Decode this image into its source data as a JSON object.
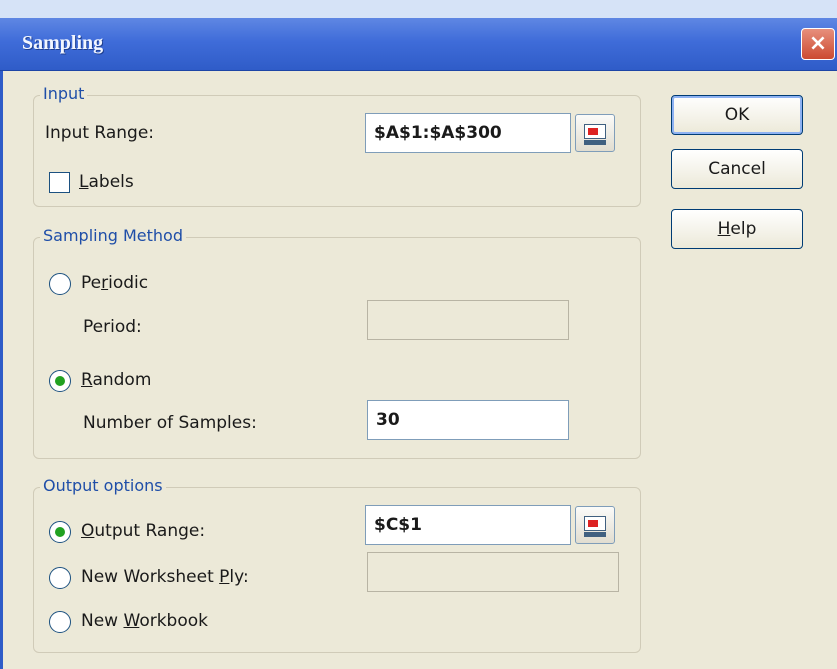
{
  "window": {
    "title": "Sampling",
    "close_glyph": "×"
  },
  "input": {
    "legend": "Input",
    "range_label": "Input Range:",
    "range_value": "$A$1:$A$300",
    "labels_checkbox": {
      "label_pre": "",
      "label_accel": "L",
      "label_post": "abels",
      "checked": false
    }
  },
  "method": {
    "legend": "Sampling Method",
    "periodic": {
      "pre": "Pe",
      "accel": "r",
      "post": "iodic",
      "selected": false
    },
    "period_label": "Period:",
    "period_value": "",
    "random": {
      "pre": "",
      "accel": "R",
      "post": "andom",
      "selected": true
    },
    "samples_label": "Number of Samples:",
    "samples_value": "30"
  },
  "output": {
    "legend": "Output options",
    "output_range": {
      "pre": "",
      "accel": "O",
      "post": "utput Range:",
      "selected": true
    },
    "output_range_value": "$C$1",
    "new_ply": {
      "pre": "New Worksheet ",
      "accel": "P",
      "post": "ly:",
      "selected": false
    },
    "new_ply_value": "",
    "new_workbook": {
      "pre": "New ",
      "accel": "W",
      "post": "orkbook",
      "selected": false
    }
  },
  "buttons": {
    "ok": "OK",
    "cancel": "Cancel",
    "help": {
      "pre": "",
      "accel": "H",
      "post": "elp"
    }
  },
  "colors": {
    "title_bar": "#3f6cd9",
    "dialog_bg": "#ece9d8",
    "legend_text": "#1f4ea8",
    "radio_dot": "#21a121"
  }
}
